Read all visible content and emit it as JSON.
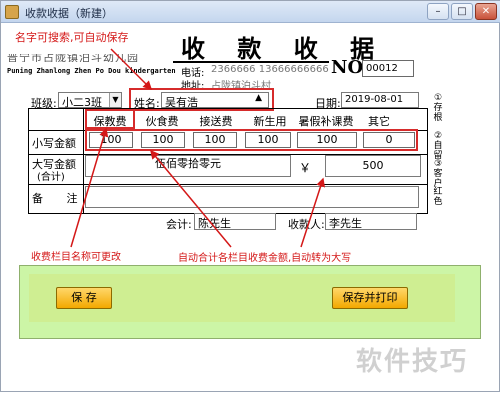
{
  "window": {
    "title": "收款收据（新建）",
    "minimize": "–",
    "maximize": "□",
    "close": "✕"
  },
  "notes": {
    "search_hint": "名字可搜索,可自动保存",
    "category_hint": "收费栏目名称可更改",
    "auto_total_hint": "自动合计各栏目收费金额,自动转为大写"
  },
  "receipt": {
    "title": "收 款 收 据",
    "school_en": "Puning Zhanlong Zhen Po Dou kindergarten",
    "school_cn_obscured": "普宁市占陇镇泊斗幼儿园",
    "phone_label": "电话:",
    "phone_value": "2366666  13666666666",
    "address_label": "地址:",
    "address_value": "占陇镇泊斗村",
    "no_label": "NO:",
    "no_value": "00012"
  },
  "form": {
    "class_label": "班级:",
    "class_value": "小二3班",
    "name_label": "姓名:",
    "name_value": "吴有浩",
    "date_label": "日期:",
    "date_value": "2019-08-01"
  },
  "fees": {
    "columns": [
      "保教费",
      "伙食费",
      "接送费",
      "新生用",
      "暑假补课费",
      "其它"
    ],
    "amounts": [
      "100",
      "100",
      "100",
      "100",
      "100",
      "0"
    ],
    "small_label": "小写金额",
    "big_label": "大写金额",
    "big_label_sub": "(合计)",
    "big_value": "伍佰零拾零元",
    "currency": "￥",
    "total": "500",
    "remark_label": "备 注",
    "remark_value": ""
  },
  "signatures": {
    "accountant_label": "会计:",
    "accountant_value": "陈先生",
    "payee_label": "收款人:",
    "payee_value": "李先生"
  },
  "side_text": [
    "①存根",
    "②自留",
    "③客户",
    "红色"
  ],
  "actions": {
    "save": "保 存",
    "save_print": "保存并打印"
  },
  "watermark": "软件技巧"
}
